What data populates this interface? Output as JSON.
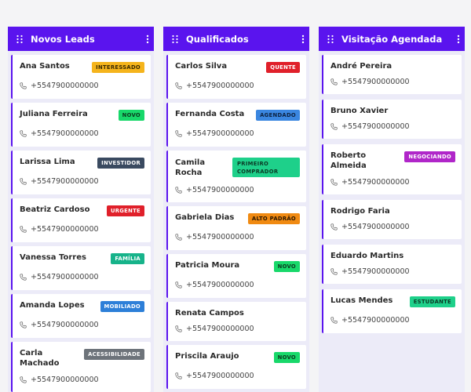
{
  "columns": [
    {
      "title": "Novos Leads",
      "cards": [
        {
          "name": "Ana Santos",
          "phone": "+5547900000000",
          "tag": "INTERESSADO"
        },
        {
          "name": "Juliana Ferreira",
          "phone": "+5547900000000",
          "tag": "NOVO"
        },
        {
          "name": "Larissa Lima",
          "phone": "+5547900000000",
          "tag": "INVESTIDOR"
        },
        {
          "name": "Beatriz Cardoso",
          "phone": "+5547900000000",
          "tag": "URGENTE"
        },
        {
          "name": "Vanessa Torres",
          "phone": "+5547900000000",
          "tag": "FAMÍLIA"
        },
        {
          "name": "Amanda Lopes",
          "phone": "+5547900000000",
          "tag": "MOBILIADO"
        },
        {
          "name": "Carla Machado",
          "phone": "+5547900000000",
          "tag": "ACESSIBILIDADE"
        }
      ]
    },
    {
      "title": "Qualificados",
      "cards": [
        {
          "name": "Carlos Silva",
          "phone": "+5547900000000",
          "tag": "QUENTE"
        },
        {
          "name": "Fernanda Costa",
          "phone": "+5547900000000",
          "tag": "AGENDADO"
        },
        {
          "name": "Camila Rocha",
          "phone": "+5547900000000",
          "tag": "PRIMEIRO COMPRADOR"
        },
        {
          "name": "Gabriela Dias",
          "phone": "+5547900000000",
          "tag": "ALTO PADRÃO"
        },
        {
          "name": "Patricia Moura",
          "phone": "+5547900000000",
          "tag": "NOVO"
        },
        {
          "name": "Renata Campos",
          "phone": "+5547900000000",
          "tag": ""
        },
        {
          "name": "Priscila Araujo",
          "phone": "+5547900000000",
          "tag": "NOVO"
        }
      ]
    },
    {
      "title": "Visitação Agendada",
      "cards": [
        {
          "name": "André Pereira",
          "phone": "+5547900000000",
          "tag": ""
        },
        {
          "name": "Bruno Xavier",
          "phone": "+5547900000000",
          "tag": ""
        },
        {
          "name": "Roberto Almeida",
          "phone": "+5547900000000",
          "tag": "NEGOCIANDO"
        },
        {
          "name": "Rodrigo Faria",
          "phone": "+5547900000000",
          "tag": ""
        },
        {
          "name": "Eduardo Martins",
          "phone": "+5547900000000",
          "tag": ""
        },
        {
          "name": "Lucas Mendes",
          "phone": "+5547900000000",
          "tag": "ESTUDANTE"
        }
      ]
    }
  ],
  "colors": {
    "header": "#5a14ee",
    "column_bg": "#ecebf8",
    "card_accent": "#5a14ee"
  },
  "icons": {
    "column_drag": "grip-icon",
    "column_menu": "kebab-icon",
    "card_phone": "phone-icon"
  }
}
